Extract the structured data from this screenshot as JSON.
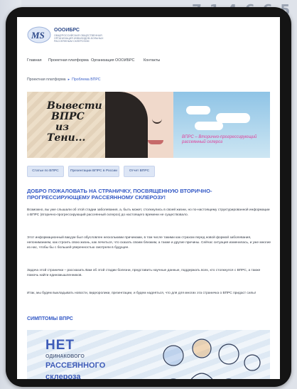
{
  "background": {
    "digits": "7 1 4 6 6 5"
  },
  "site": {
    "logo_name": "ОООИБРС",
    "logo_sub": "ОБЩЕРОССИЙСКАЯ ОБЩЕСТВЕННАЯ ОРГАНИЗАЦИЯ ИНВАЛИДОВ-БОЛЬНЫХ РАССЕЯННЫМ СКЛЕРОЗОМ"
  },
  "nav": {
    "items": [
      "Главная",
      "Проектная платформа",
      "Организация ОООИБРС",
      "Контакты"
    ]
  },
  "breadcrumb": {
    "items": [
      "Проектная платформа",
      "Проблема ВПРС"
    ]
  },
  "banner": {
    "title_line1": "Вывести",
    "title_line2": "ВПРС",
    "title_line3": "из",
    "title_line4": "Тени...",
    "caption": "ВПРС – Вторично-прогрессирующий рассеянный склероз"
  },
  "tabs": [
    "Статьи по ВПРС",
    "Презентации ВПРС в России",
    "Отчет ВПРС"
  ],
  "article": {
    "heading": "ДОБРО ПОЖАЛОВАТЬ НА СТРАНИЧКУ, ПОСВЯЩЕННУЮ ВТОРИЧНО-ПРОГРЕССИРУЮЩЕМУ РАССЕЯННОМУ СКЛЕРОЗУ!",
    "p1": "Возможно, вы уже слышали об этой стадии заболевания, а, быть может, столкнулись в своей жизни, но по-настоящему структурированной информации о ВПРС (вторично-прогрессирующий рассеянный склероз) до настоящего времени не существовало.",
    "p2": "Этот информационный вакуум был обусловлен несколькими причинами, в том числе такими как страхом перед новой формой заболевания, непониманием, как строить свою жизнь, как лечиться, что сказать своим близким, а также и другие причины. Сейчас ситуация изменилась, и уже многие из нас, чтобы бы с большей уверенностью смотрели в будущее.",
    "p3": "Задача этой странички – рассказать Вам об этой стадии болезни, представить научные данные, поддержать всех, кто столкнулся с ВПРС, а также помочь найти единомышленников.",
    "p4": "Итак, мы будем выкладывать новости, видеоролики, презентации, и будем надеяться, что для для многих эта страничка о ВПРС придаст силы!",
    "symptoms_heading": "СИМПТОМЫ ВПРС"
  },
  "symptoms_image": {
    "line1": "НЕТ",
    "line2": "ОДИНАКОВОГО",
    "line3": "РАССЕЯННОГО",
    "line4": "склероза"
  },
  "colors": {
    "accent": "#3157c5",
    "tab_bg": "#dde6f6",
    "banner_caption": "#e0409a"
  }
}
